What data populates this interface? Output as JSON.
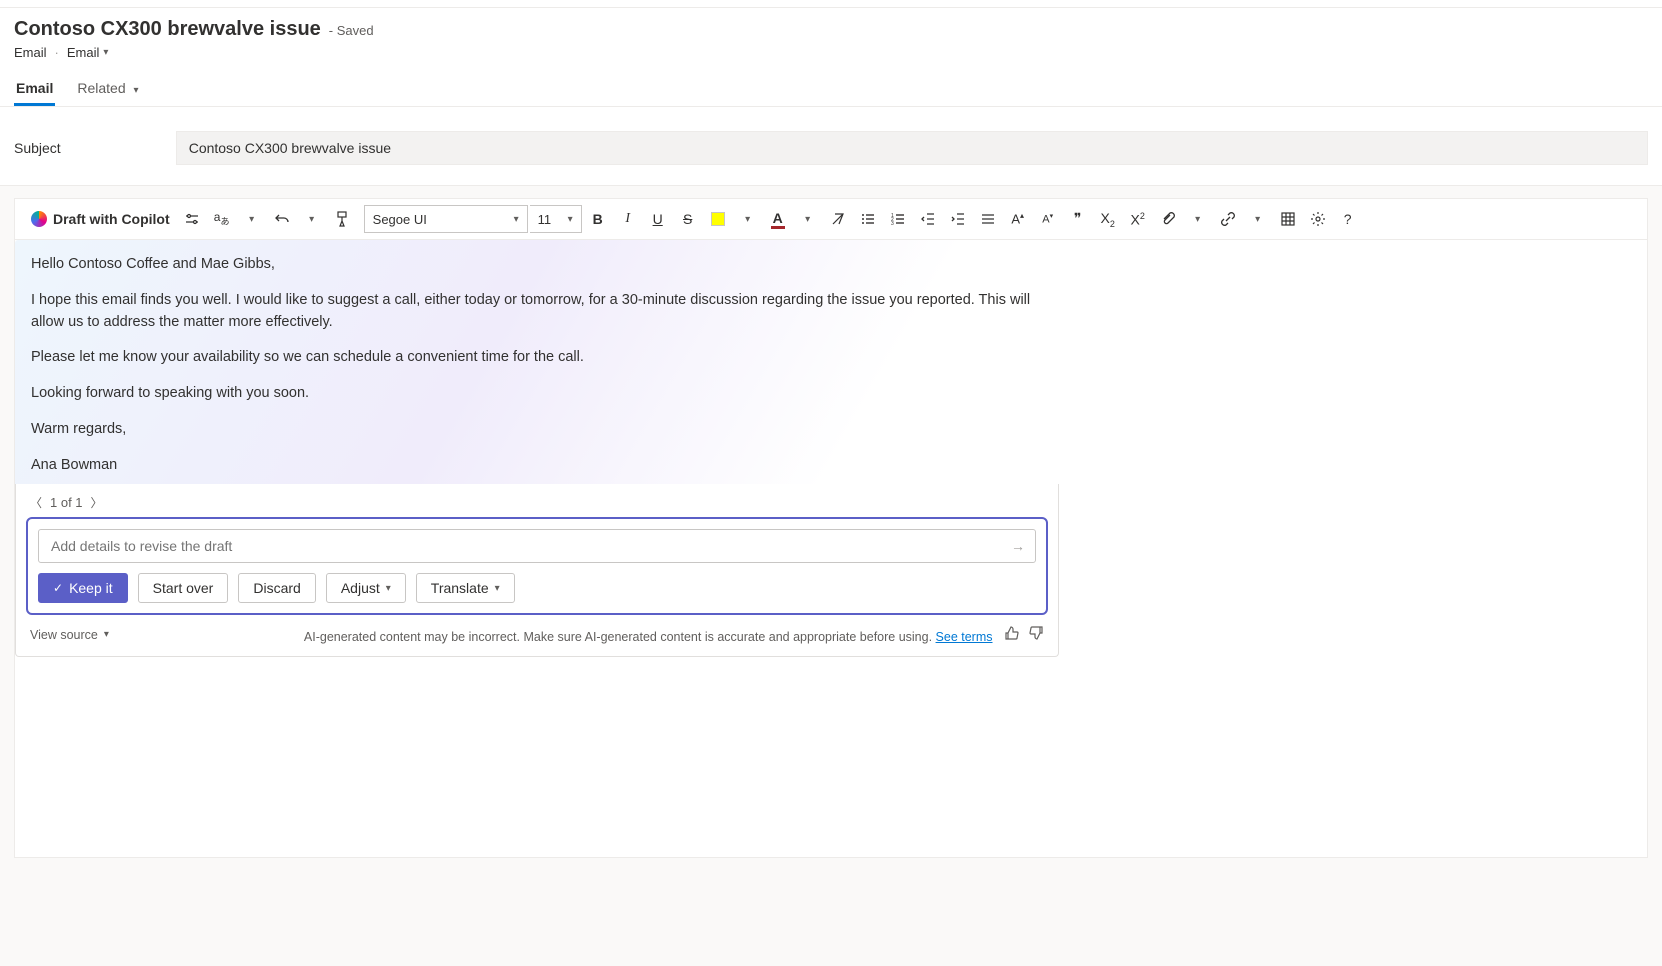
{
  "header": {
    "title": "Contoso CX300 brewvalve issue",
    "saveState": "- Saved",
    "breadcrumb": {
      "root": "Email",
      "entity": "Email"
    },
    "tabs": {
      "email": "Email",
      "related": "Related"
    }
  },
  "subject": {
    "label": "Subject",
    "value": "Contoso CX300 brewvalve issue"
  },
  "toolbar": {
    "copilotLabel": "Draft with Copilot",
    "fontName": "Segoe UI",
    "fontSize": "11"
  },
  "emailBody": {
    "p1": "Hello Contoso Coffee and Mae Gibbs,",
    "p2": "I hope this email finds you well. I would like to suggest a call, either today or tomorrow, for a 30-minute discussion regarding the issue you reported. This will allow us to address the matter more effectively.",
    "p3": "Please let me know your availability so we can schedule a convenient time for the call.",
    "p4": "Looking forward to speaking with you soon.",
    "p5": "Warm regards,",
    "p6": "Ana Bowman"
  },
  "copilotPanel": {
    "pager": "1 of 1",
    "revisePlaceholder": "Add details to revise the draft",
    "buttons": {
      "keep": "Keep it",
      "startOver": "Start over",
      "discard": "Discard",
      "adjust": "Adjust",
      "translate": "Translate"
    },
    "viewSource": "View source",
    "disclaimer": "AI-generated content may be incorrect. Make sure AI-generated content is accurate and appropriate before using.",
    "seeTerms": "See terms"
  }
}
